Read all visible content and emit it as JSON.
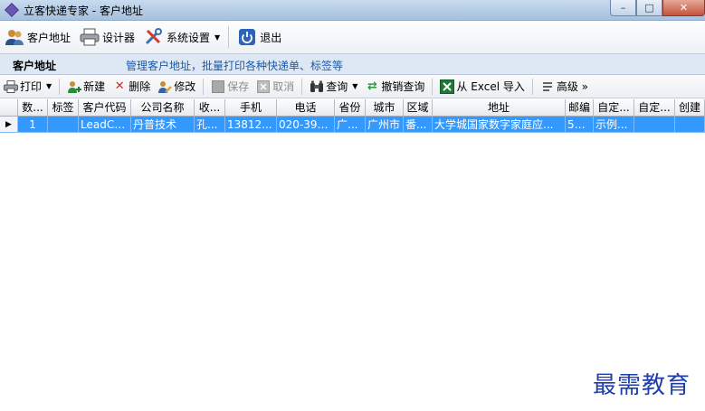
{
  "window": {
    "title": "立客快递专家 - 客户地址",
    "controls": {
      "minimize": "–",
      "maximize": "□",
      "close": "✕"
    }
  },
  "main_toolbar": {
    "items": [
      {
        "label": "客户地址",
        "icon": "user-group-icon"
      },
      {
        "label": "设计器",
        "icon": "printer-icon"
      },
      {
        "label": "系统设置",
        "icon": "tools-icon",
        "dropdown": true
      },
      {
        "label": "退出",
        "icon": "power-icon"
      }
    ]
  },
  "header": {
    "title": "客户地址",
    "description": "管理客户地址，批量打印各种快递单、标签等"
  },
  "sub_toolbar": {
    "print": "打印",
    "new": "新建",
    "delete": "删除",
    "edit": "修改",
    "save": "保存",
    "cancel": "取消",
    "query": "查询",
    "cancel_query": "撤销查询",
    "import_excel": "从 Excel 导入",
    "advanced": "高级 »"
  },
  "table": {
    "columns": [
      "数...",
      "标签",
      "客户代码",
      "公司名称",
      "收...",
      "手机",
      "电话",
      "省份",
      "城市",
      "区域",
      "地址",
      "邮编",
      "自定...",
      "自定...",
      "创建"
    ],
    "rows": [
      [
        "1",
        "",
        "LeadCarry",
        "丹普技术",
        "孔...",
        "13812...",
        "020-393...",
        "广...",
        "广州市",
        "番...",
        "大学城国家数字家庭应...",
        "50...",
        "示例...",
        "",
        ""
      ]
    ]
  },
  "watermark": "最需教育",
  "colors": {
    "selection": "#3399ff",
    "header_desc": "#1c5aa8",
    "watermark": "#1f3ea8"
  }
}
